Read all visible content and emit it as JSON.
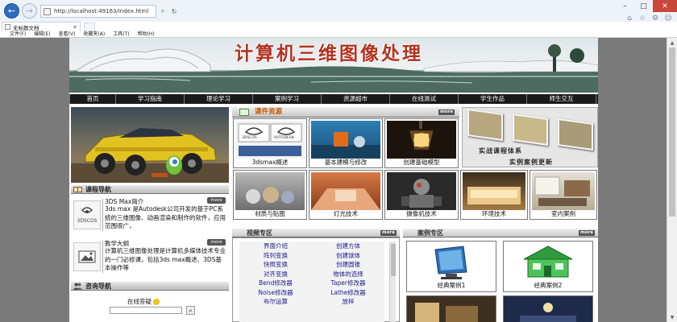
{
  "browser": {
    "url": "http://localhost:49163/index.html",
    "tab_title": "无标题文档",
    "menus": [
      "文件(F)",
      "编辑(E)",
      "查看(V)",
      "收藏夹(A)",
      "工具(T)",
      "帮助(H)"
    ]
  },
  "banner": {
    "title": "计算机三维图像处理"
  },
  "nav": [
    "首页",
    "学习指南",
    "理论学习",
    "案例学习",
    "资源超市",
    "在线测试",
    "学生作品",
    "师生交互"
  ],
  "left": {
    "course_nav_title": "课程导航",
    "courses": [
      {
        "title": "3DS Max简介",
        "more": "more",
        "icon_label": "3DSCOS",
        "desc": "3ds max 是Autodesk公司开发的基于PC系统的三维图像、动画渲染和制作的软件，应用范围很广，"
      },
      {
        "title": "教学大纲",
        "more": "more",
        "desc": "计算机三维图像处理是计算机多媒体技术专业的一门必修课，包括3ds max概述、3DS基本操作等"
      }
    ],
    "consult_title": "咨询导航",
    "online_label": "在线答疑",
    "search_btn": "⌕"
  },
  "resources": {
    "title": "课件资源",
    "more": "more",
    "items": [
      "3dsmax概述",
      "基本建模与修改",
      "创建基础模型",
      "材质与贴图",
      "灯光技术",
      "摄像机技术",
      "环境技术",
      "室内案例"
    ],
    "logo_text_1": "3DSCOS",
    "logo_text_2": "AUTODESK"
  },
  "promo": {
    "line1": "实战课程体系",
    "line2": "实例案例更新"
  },
  "video": {
    "title": "视频专区",
    "more": "more",
    "rows": [
      [
        "界面介绍",
        "创建方体"
      ],
      [
        "阵列变换",
        "创建球体"
      ],
      [
        "快照变换",
        "创建圆锥"
      ],
      [
        "对齐变换",
        "物体的选择"
      ],
      [
        "Bend修改器",
        "Taper修改器"
      ],
      [
        "Noise修改器",
        "Lathe修改器"
      ],
      [
        "布尔运算",
        "放样"
      ]
    ]
  },
  "cases": {
    "title": "案例专区",
    "more": "more",
    "items": [
      "经典案例1",
      "经典案例2"
    ]
  },
  "colors": {
    "nav_bg": "#1a1a1a",
    "title_red": "#b3321f",
    "resource_orange": "#c25a00"
  }
}
